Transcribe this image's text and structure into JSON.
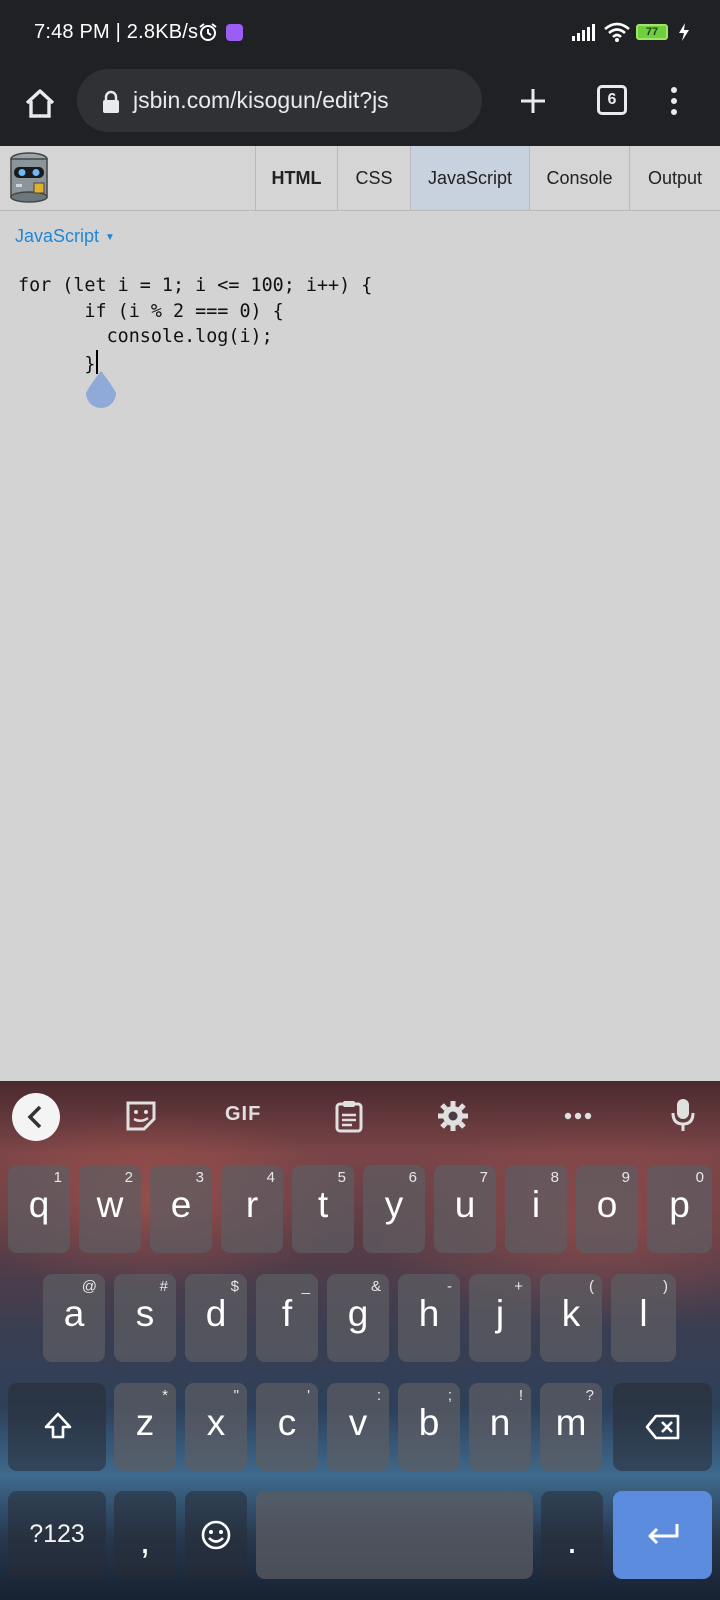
{
  "status_bar": {
    "time_text": "7:48 PM | 2.8KB/s",
    "battery_level": "77",
    "icons": [
      "alarm-icon",
      "app-notification-icon",
      "signal-icon",
      "wifi-icon",
      "battery-icon",
      "charging-icon"
    ]
  },
  "browser": {
    "url": "jsbin.com/kisogun/edit?js",
    "tab_count": "6",
    "icons": [
      "home-icon",
      "lock-icon",
      "plus-icon",
      "tab-switcher-icon",
      "more-vert-icon"
    ]
  },
  "jsbin": {
    "tabs": [
      {
        "label": "HTML",
        "bold": true,
        "active": false
      },
      {
        "label": "CSS",
        "bold": false,
        "active": false
      },
      {
        "label": "JavaScript",
        "bold": false,
        "active": true
      },
      {
        "label": "Console",
        "bold": false,
        "active": false
      },
      {
        "label": "Output",
        "bold": false,
        "active": false
      }
    ],
    "panel_language": "JavaScript"
  },
  "editor": {
    "lines": [
      "for (let i = 1; i <= 100; i++) {",
      "      if (i % 2 === 0) {",
      "        console.log(i);",
      "      }"
    ]
  },
  "keyboard": {
    "suggestion_bar": {
      "gif_label": "GIF",
      "icons": [
        "back-arrow-icon",
        "sticker-icon",
        "clipboard-icon",
        "settings-icon",
        "more-horiz-icon",
        "microphone-icon"
      ]
    },
    "row1": [
      {
        "key": "q",
        "hint": "1"
      },
      {
        "key": "w",
        "hint": "2"
      },
      {
        "key": "e",
        "hint": "3"
      },
      {
        "key": "r",
        "hint": "4"
      },
      {
        "key": "t",
        "hint": "5"
      },
      {
        "key": "y",
        "hint": "6"
      },
      {
        "key": "u",
        "hint": "7"
      },
      {
        "key": "i",
        "hint": "8"
      },
      {
        "key": "o",
        "hint": "9"
      },
      {
        "key": "p",
        "hint": "0"
      }
    ],
    "row2": [
      {
        "key": "a",
        "hint": "@"
      },
      {
        "key": "s",
        "hint": "#"
      },
      {
        "key": "d",
        "hint": "$"
      },
      {
        "key": "f",
        "hint": "_"
      },
      {
        "key": "g",
        "hint": "&"
      },
      {
        "key": "h",
        "hint": "-"
      },
      {
        "key": "j",
        "hint": "+"
      },
      {
        "key": "k",
        "hint": "("
      },
      {
        "key": "l",
        "hint": ")"
      }
    ],
    "row3": [
      {
        "key": "z",
        "hint": "*"
      },
      {
        "key": "x",
        "hint": "\""
      },
      {
        "key": "c",
        "hint": "'"
      },
      {
        "key": "v",
        "hint": ":"
      },
      {
        "key": "b",
        "hint": ";"
      },
      {
        "key": "n",
        "hint": "!"
      },
      {
        "key": "m",
        "hint": "?"
      }
    ],
    "symbols_label": "?123",
    "comma": ",",
    "period": ".",
    "special_icons": [
      "shift-icon",
      "backspace-icon",
      "emoji-icon",
      "enter-icon"
    ]
  }
}
